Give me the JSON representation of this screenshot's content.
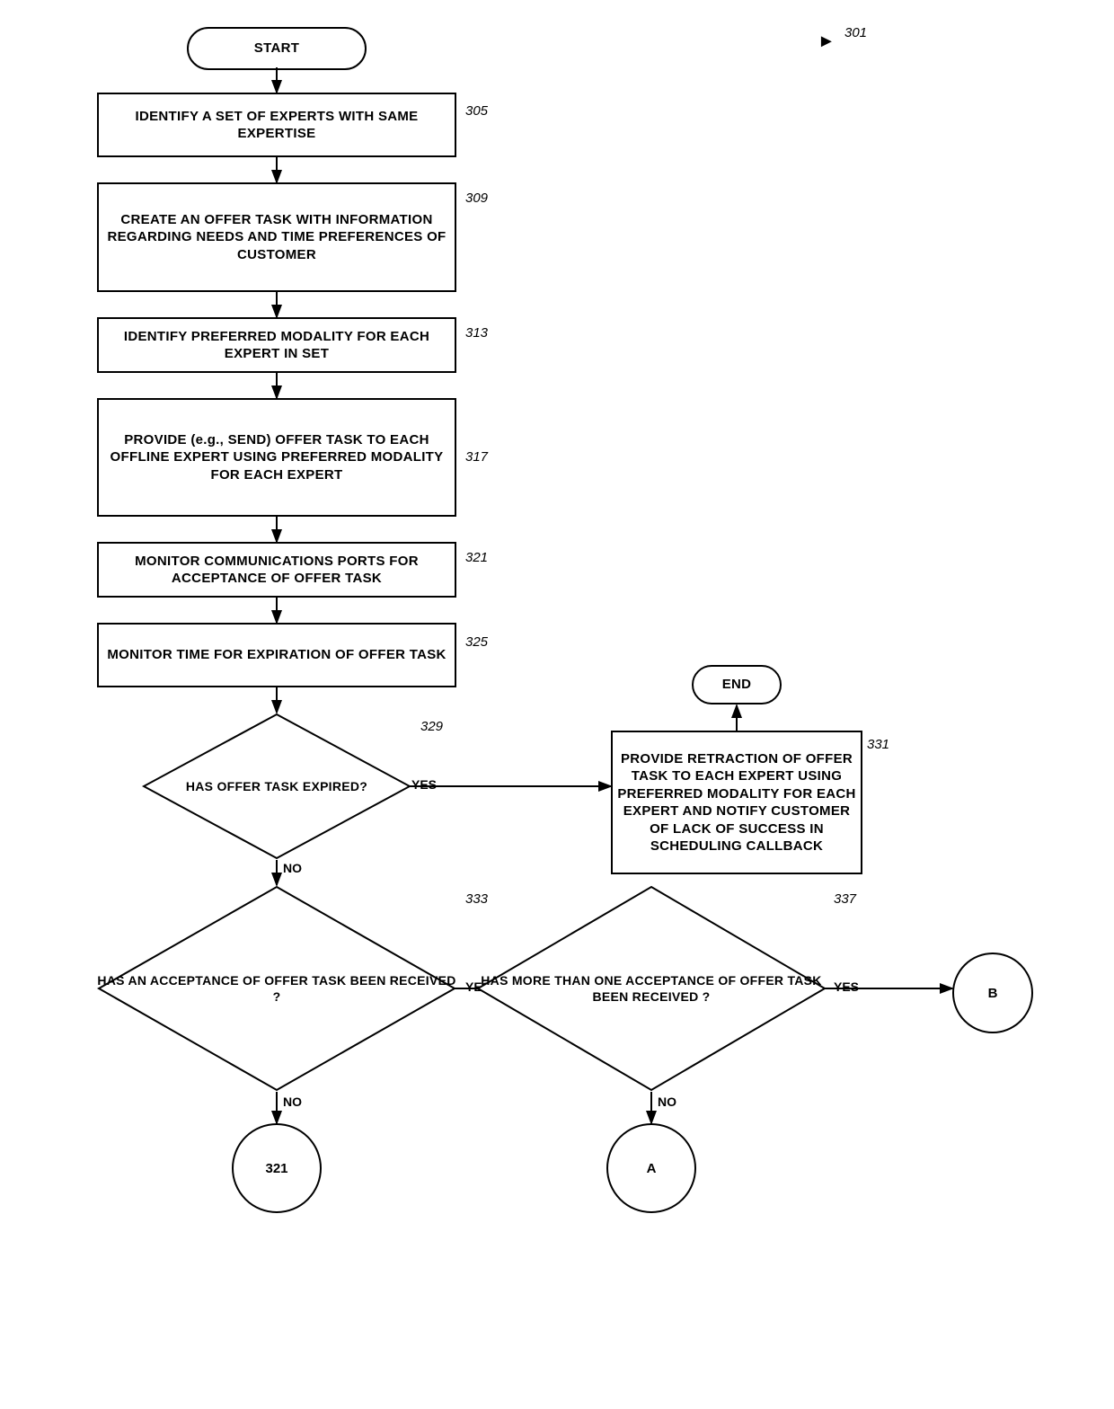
{
  "diagram": {
    "title": "301",
    "nodes": {
      "start": "START",
      "n305": "IDENTIFY A SET OF EXPERTS WITH SAME EXPERTISE",
      "n309": "CREATE AN OFFER TASK WITH INFORMATION REGARDING NEEDS AND TIME PREFERENCES OF CUSTOMER",
      "n313": "IDENTIFY PREFERRED MODALITY FOR EACH EXPERT IN SET",
      "n317": "PROVIDE (e.g., SEND) OFFER TASK TO EACH OFFLINE EXPERT USING PREFERRED MODALITY FOR EACH EXPERT",
      "n321": "MONITOR COMMUNICATIONS PORTS FOR ACCEPTANCE OF OFFER TASK",
      "n325": "MONITOR TIME FOR EXPIRATION OF OFFER TASK",
      "n329_label": "329",
      "n329_q": "HAS OFFER TASK EXPIRED?",
      "n329_yes": "YES",
      "n329_no": "NO",
      "n331_label": "331",
      "n331": "PROVIDE RETRACTION OF OFFER TASK TO EACH EXPERT USING PREFERRED MODALITY FOR EACH EXPERT AND NOTIFY CUSTOMER OF LACK OF SUCCESS IN SCHEDULING CALLBACK",
      "end": "END",
      "n333_label": "333",
      "n333_q": "HAS AN ACCEPTANCE OF OFFER TASK BEEN RECEIVED ?",
      "n333_yes": "YES",
      "n333_no": "NO",
      "n337_label": "337",
      "n337_q": "HAS MORE THAN ONE ACCEPTANCE OF OFFER TASK BEEN RECEIVED ?",
      "n337_yes": "YES",
      "n337_no": "NO",
      "circle_321": "321",
      "circle_B": "B",
      "circle_A": "A",
      "label_305": "305",
      "label_309": "309",
      "label_313": "313",
      "label_317": "317",
      "label_321": "321",
      "label_325": "325"
    }
  }
}
